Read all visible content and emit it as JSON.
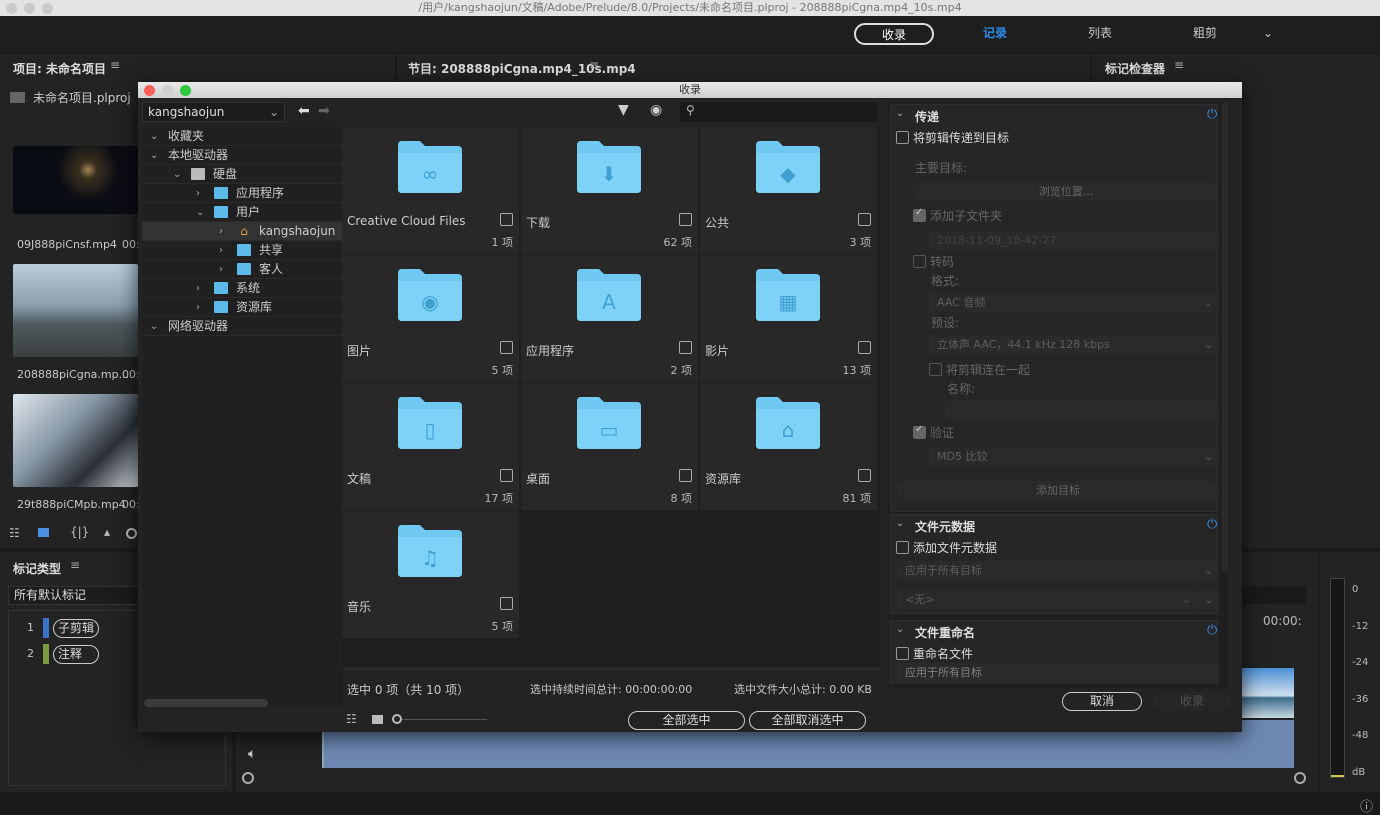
{
  "window": {
    "title": "/用户/kangshaojun/文稿/Adobe/Prelude/8.0/Projects/未命名项目.plproj - 208888piCgna.mp4_10s.mp4"
  },
  "toolbar": {
    "ingest": "收录",
    "log": "记录",
    "list": "列表",
    "rough_cut": "粗剪",
    "accent": "#2d8ceb"
  },
  "project_panel": {
    "title": "项目: 未命名项目",
    "project_file": "未命名项目.plproj",
    "clips": [
      {
        "name": "09J888piCnsf.mp4",
        "time": "00:"
      },
      {
        "name": "208888piCgna.mp...",
        "time": "00:"
      },
      {
        "name": "29t888piCMpb.mp4",
        "time": "00:"
      }
    ]
  },
  "program_panel": {
    "title": "节目: 208888piCgna.mp4_10s.mp4",
    "timecode": "00:00:"
  },
  "inspector_panel": {
    "title": "标记检查器"
  },
  "marker_panel": {
    "title": "标记类型",
    "filter": "所有默认标记",
    "items": [
      {
        "num": "1",
        "label": "子剪辑",
        "color": "#3a73c9"
      },
      {
        "num": "2",
        "label": "注释",
        "color": "#7d9a3c"
      }
    ]
  },
  "audio_meter": {
    "ticks": [
      "0",
      "-12",
      "-24",
      "-36",
      "-48",
      "dB"
    ]
  },
  "dialog": {
    "title": "收录",
    "location": "kangshaojun",
    "search_placeholder": "",
    "tree": [
      {
        "label": "收藏夹",
        "level": 0,
        "expanded": true
      },
      {
        "label": "本地驱动器",
        "level": 0,
        "expanded": true
      },
      {
        "label": "硬盘",
        "level": 1,
        "expanded": true,
        "icon": "disk"
      },
      {
        "label": "应用程序",
        "level": 2,
        "expanded": false,
        "icon": "folder"
      },
      {
        "label": "用户",
        "level": 2,
        "expanded": true,
        "icon": "folder"
      },
      {
        "label": "kangshaojun",
        "level": 3,
        "expanded": false,
        "icon": "home",
        "selected": true
      },
      {
        "label": "共享",
        "level": 3,
        "expanded": false,
        "icon": "folder"
      },
      {
        "label": "客人",
        "level": 3,
        "expanded": false,
        "icon": "folder"
      },
      {
        "label": "系统",
        "level": 2,
        "expanded": false,
        "icon": "folder"
      },
      {
        "label": "资源库",
        "level": 2,
        "expanded": false,
        "icon": "folder"
      },
      {
        "label": "网络驱动器",
        "level": 0,
        "expanded": true
      }
    ],
    "folders": [
      {
        "name": "Creative Cloud Files",
        "count": "1 项",
        "glyph": "∞"
      },
      {
        "name": "下载",
        "count": "62 项",
        "glyph": "⬇"
      },
      {
        "name": "公共",
        "count": "3 项",
        "glyph": "◆"
      },
      {
        "name": "图片",
        "count": "5 项",
        "glyph": "◉"
      },
      {
        "name": "应用程序",
        "count": "2 项",
        "glyph": "A"
      },
      {
        "name": "影片",
        "count": "13 项",
        "glyph": "▦"
      },
      {
        "name": "文稿",
        "count": "17 项",
        "glyph": "▯"
      },
      {
        "name": "桌面",
        "count": "8 项",
        "glyph": "▭"
      },
      {
        "name": "资源库",
        "count": "81 项",
        "glyph": "⌂"
      },
      {
        "name": "音乐",
        "count": "5 项",
        "glyph": "♫"
      }
    ],
    "folder_color": "#6ec8f2",
    "status": {
      "selected": "选中 0 项（共 10 项）",
      "duration": "选中持续时间总计: 00:00:00:00",
      "size": "选中文件大小总计: 0.00 KB"
    },
    "select_all": "全部选中",
    "deselect_all": "全部取消选中",
    "transfer": {
      "title": "传递",
      "enable": "将剪辑传递到目标",
      "primary_dest": "主要目标:",
      "browse": "浏览位置...",
      "add_subfolder": "添加子文件夹",
      "subfolder_value": "2018-11-09_10-42-27",
      "transcode": "转码",
      "format_label": "格式:",
      "format": "AAC 音频",
      "preset_label": "预设:",
      "preset": "立体声 AAC，44.1 kHz 128 kbps",
      "concat": "将剪辑连在一起",
      "name_label": "名称:",
      "verify": "验证",
      "verify_method": "MD5 比较",
      "add_dest": "添加目标"
    },
    "metadata": {
      "title": "文件元数据",
      "enable": "添加文件元数据",
      "apply": "应用于所有目标",
      "template": "<无>"
    },
    "rename": {
      "title": "文件重命名",
      "enable": "重命名文件",
      "apply": "应用于所有目标"
    },
    "cancel": "取消",
    "ingest": "收录"
  }
}
